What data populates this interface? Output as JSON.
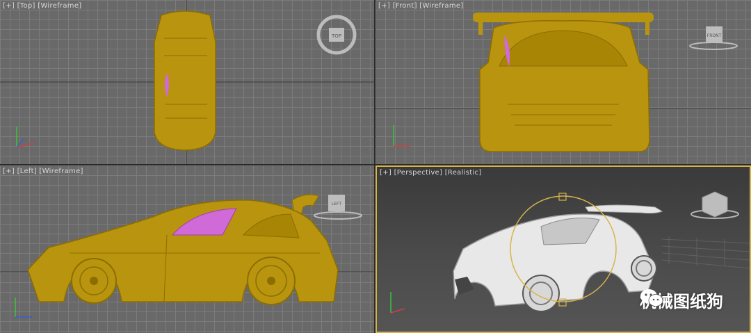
{
  "viewports": {
    "top": {
      "bracket": "[+]",
      "view": "[Top]",
      "shading": "[Wireframe]",
      "cube_label": "TOP"
    },
    "front": {
      "bracket": "[+]",
      "view": "[Front]",
      "shading": "[Wireframe]",
      "cube_label": "FRONT"
    },
    "left": {
      "bracket": "[+]",
      "view": "[Left]",
      "shading": "[Wireframe]",
      "cube_label": "LEFT"
    },
    "perspective": {
      "bracket": "[+]",
      "view": "[Perspective]",
      "shading": "[Realistic]"
    }
  },
  "watermark": {
    "text": "机械图纸狗"
  },
  "colors": {
    "wire_yellow": "#b8940f",
    "wire_dark": "#8c6e00",
    "selection_magenta": "#d06ad8",
    "active_border": "#d6b44a"
  }
}
